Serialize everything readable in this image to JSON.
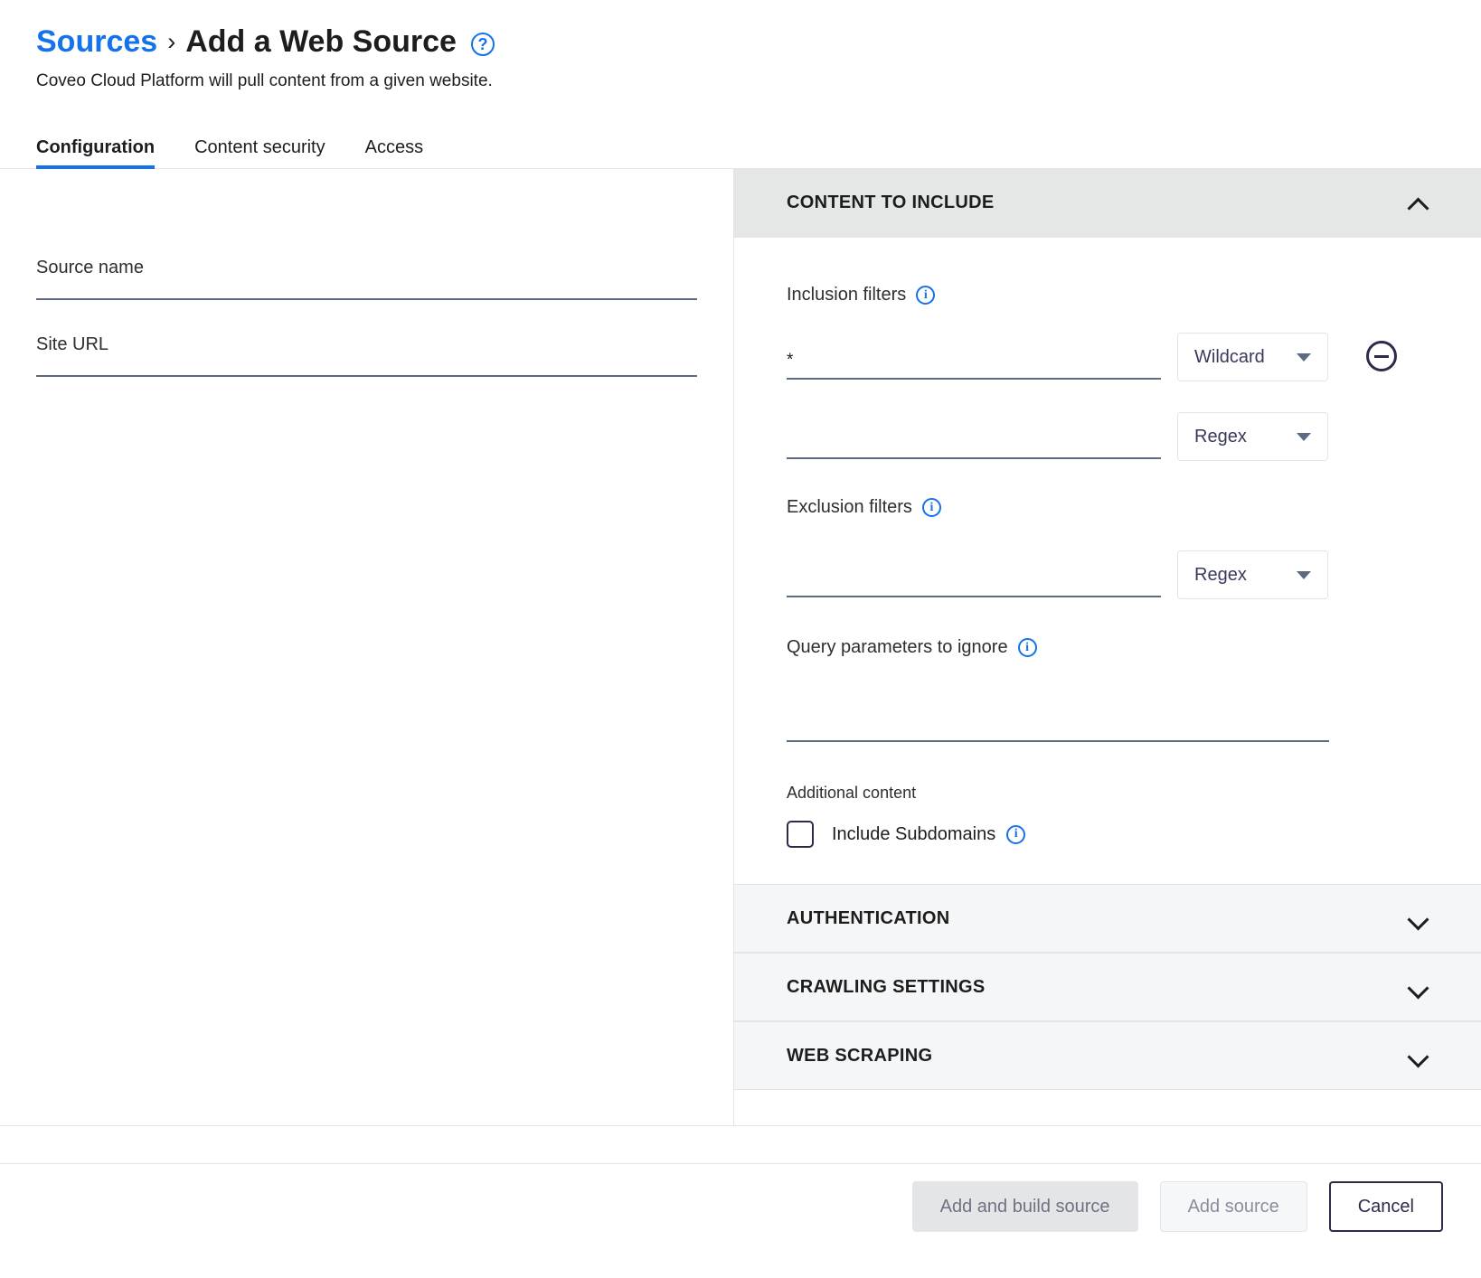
{
  "header": {
    "breadcrumb_parent": "Sources",
    "breadcrumb_separator": "›",
    "breadcrumb_current": "Add a Web Source",
    "help_glyph": "?",
    "subtitle": "Coveo Cloud Platform will pull content from a given website."
  },
  "tabs": [
    {
      "label": "Configuration",
      "active": true
    },
    {
      "label": "Content security",
      "active": false
    },
    {
      "label": "Access",
      "active": false
    }
  ],
  "left_form": {
    "source_name": {
      "label": "Source name",
      "value": ""
    },
    "site_url": {
      "label": "Site URL",
      "value": ""
    }
  },
  "sections": {
    "content_to_include": {
      "title": "CONTENT TO INCLUDE",
      "expanded": true,
      "inclusion_filters": {
        "label": "Inclusion filters",
        "info_glyph": "i",
        "rows": [
          {
            "value": "*",
            "type": "Wildcard",
            "removable": true
          },
          {
            "value": "",
            "type": "Regex",
            "removable": false
          }
        ]
      },
      "exclusion_filters": {
        "label": "Exclusion filters",
        "info_glyph": "i",
        "rows": [
          {
            "value": "",
            "type": "Regex",
            "removable": false
          }
        ]
      },
      "query_parameters": {
        "label": "Query parameters to ignore",
        "info_glyph": "i",
        "value": ""
      },
      "additional_content": {
        "label": "Additional content",
        "checkbox_label": "Include Subdomains",
        "checked": false,
        "info_glyph": "i"
      }
    },
    "authentication": {
      "title": "AUTHENTICATION",
      "expanded": false
    },
    "crawling_settings": {
      "title": "CRAWLING SETTINGS",
      "expanded": false
    },
    "web_scraping": {
      "title": "WEB SCRAPING",
      "expanded": false
    }
  },
  "footer": {
    "add_and_build_source": "Add and build source",
    "add_source": "Add source",
    "cancel": "Cancel"
  },
  "colors": {
    "accent_blue": "#1372ec",
    "dark_navy": "#2b2b4a",
    "underline": "#5b6b82",
    "panel_header_open": "#e5e7e6",
    "panel_header_closed": "#f5f6f8"
  }
}
